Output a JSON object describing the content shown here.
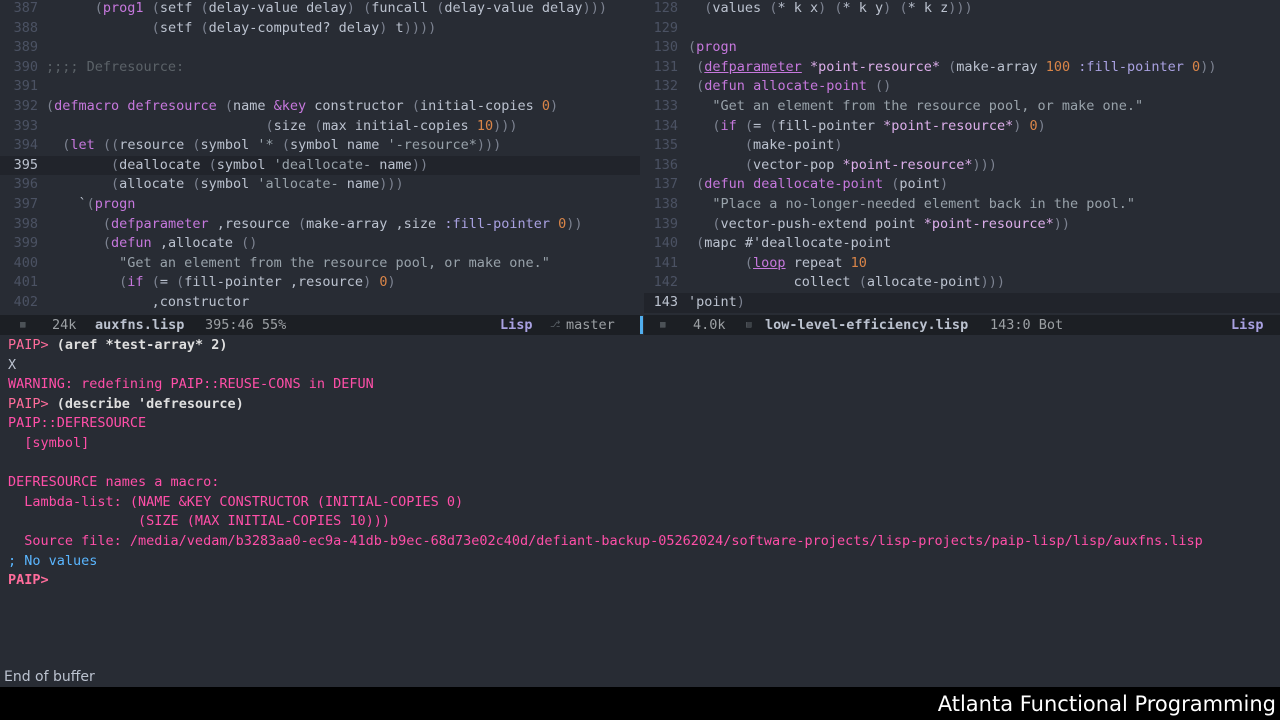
{
  "left_editor": {
    "lines": [
      {
        "num": "387",
        "html": "      <span class='c-paren'>(</span><span class='c-kw'>prog1</span> <span class='c-paren'>(</span>setf <span class='c-paren'>(</span>delay-value delay<span class='c-paren'>)</span> <span class='c-paren'>(</span>funcall <span class='c-paren'>(</span>delay-value delay<span class='c-paren'>)))</span>"
      },
      {
        "num": "388",
        "html": "             <span class='c-paren'>(</span>setf <span class='c-paren'>(</span>delay-computed? delay<span class='c-paren'>)</span> t<span class='c-paren'>))))</span>"
      },
      {
        "num": "389",
        "html": ""
      },
      {
        "num": "390",
        "html": "<span class='c-comment'>;;;; Defresource:</span>"
      },
      {
        "num": "391",
        "html": ""
      },
      {
        "num": "392",
        "html": "<span class='c-paren'>(</span><span class='c-kw'>defmacro</span> <span class='c-fn'>defresource</span> <span class='c-paren'>(</span>name <span class='c-kw'>&amp;key</span> constructor <span class='c-paren'>(</span>initial-copies <span class='c-num'>0</span><span class='c-paren'>)</span>"
      },
      {
        "num": "393",
        "html": "                           <span class='c-paren'>(</span>size <span class='c-paren'>(</span>max initial-copies <span class='c-num'>10</span><span class='c-paren'>)))</span>"
      },
      {
        "num": "394",
        "html": "  <span class='c-paren'>(</span><span class='c-kw'>let</span> <span class='c-paren'>((</span>resource <span class='c-paren'>(</span>symbol <span class='c-str'>'*</span> <span class='c-paren'>(</span>symbol name <span class='c-str'>'-resource*</span><span class='c-paren'>)))</span>"
      },
      {
        "num": "395",
        "html": "        <span class='c-paren'>(</span>deallocate <span class='c-paren'>(</span>symbol <span class='c-str'>'deallocate-</span> name<span class='c-paren'>))</span>",
        "current": true
      },
      {
        "num": "396",
        "html": "        <span class='c-paren'>(</span>allocate <span class='c-paren'>(</span>symbol <span class='c-str'>'allocate-</span> name<span class='c-paren'>)))</span>"
      },
      {
        "num": "397",
        "html": "    `<span class='c-paren'>(</span><span class='c-kw'>progn</span>"
      },
      {
        "num": "398",
        "html": "       <span class='c-paren'>(</span><span class='c-kw'>defparameter</span> ,resource <span class='c-paren'>(</span>make-array ,size <span class='c-key'>:fill-pointer</span> <span class='c-num'>0</span><span class='c-paren'>))</span>"
      },
      {
        "num": "399",
        "html": "       <span class='c-paren'>(</span><span class='c-kw'>defun</span> ,allocate <span class='c-paren'>()</span>"
      },
      {
        "num": "400",
        "html": "         <span class='c-str'>\"Get an element from the resource pool, or make one.\"</span>"
      },
      {
        "num": "401",
        "html": "         <span class='c-paren'>(</span><span class='c-kw'>if</span> <span class='c-paren'>(</span>= <span class='c-paren'>(</span>fill-pointer ,resource<span class='c-paren'>)</span> <span class='c-num'>0</span><span class='c-paren'>)</span>"
      },
      {
        "num": "402",
        "html": "             ,constructor"
      }
    ]
  },
  "right_editor": {
    "lines": [
      {
        "num": "128",
        "html": "  <span class='c-paren'>(</span>values <span class='c-paren'>(</span>* k x<span class='c-paren'>)</span> <span class='c-paren'>(</span>* k y<span class='c-paren'>)</span> <span class='c-paren'>(</span>* k z<span class='c-paren'>)))</span>"
      },
      {
        "num": "129",
        "html": ""
      },
      {
        "num": "130",
        "html": "<span class='c-paren'>(</span><span class='c-kw'>progn</span>"
      },
      {
        "num": "131",
        "html": " <span class='c-paren'>(</span><span class='c-kw' style='text-decoration:underline'>defparameter</span> <span class='c-var'>*point-resource*</span> <span class='c-paren'>(</span>make-array <span class='c-num'>100</span> <span class='c-key'>:fill-pointer</span> <span class='c-num'>0</span><span class='c-paren'>))</span>"
      },
      {
        "num": "132",
        "html": " <span class='c-paren'>(</span><span class='c-kw'>defun</span> <span class='c-fn'>allocate-point</span> <span class='c-paren'>()</span>"
      },
      {
        "num": "133",
        "html": "   <span class='c-str'>\"Get an element from the resource pool, or make one.\"</span>"
      },
      {
        "num": "134",
        "html": "   <span class='c-paren'>(</span><span class='c-kw'>if</span> <span class='c-paren'>(</span>= <span class='c-paren'>(</span>fill-pointer <span class='c-var'>*point-resource*</span><span class='c-paren'>)</span> <span class='c-num'>0</span><span class='c-paren'>)</span>"
      },
      {
        "num": "135",
        "html": "       <span class='c-paren'>(</span>make-point<span class='c-paren'>)</span>"
      },
      {
        "num": "136",
        "html": "       <span class='c-paren'>(</span>vector-pop <span class='c-var'>*point-resource*</span><span class='c-paren'>)))</span>"
      },
      {
        "num": "137",
        "html": " <span class='c-paren'>(</span><span class='c-kw'>defun</span> <span class='c-fn'>deallocate-point</span> <span class='c-paren'>(</span>point<span class='c-paren'>)</span>"
      },
      {
        "num": "138",
        "html": "   <span class='c-str'>\"Place a no-longer-needed element back in the pool.\"</span>"
      },
      {
        "num": "139",
        "html": "   <span class='c-paren'>(</span>vector-push-extend point <span class='c-var'>*point-resource*</span><span class='c-paren'>))</span>"
      },
      {
        "num": "140",
        "html": " <span class='c-paren'>(</span>mapc #'deallocate-point"
      },
      {
        "num": "141",
        "html": "       <span class='c-paren'>(</span><span class='c-kw' style='text-decoration:underline'>loop</span> repeat <span class='c-num'>10</span>"
      },
      {
        "num": "142",
        "html": "             collect <span class='c-paren'>(</span>allocate-point<span class='c-paren'>)))</span>"
      },
      {
        "num": "143",
        "html": "'point<span class='c-paren'>)</span>",
        "current": true
      }
    ]
  },
  "left_modeline": {
    "size": "24k",
    "buffer": "auxfns.lisp",
    "position": "395:46 55%",
    "mode": "Lisp",
    "branch": "master",
    "icon": "lisp-file-icon"
  },
  "right_modeline": {
    "size": "4.0k",
    "buffer": "low-level-efficiency.lisp",
    "position": "143:0 Bot",
    "mode": "Lisp",
    "icon": "lisp-file-icon"
  },
  "repl": {
    "lines": [
      {
        "cls": "",
        "parts": [
          {
            "c": "prompt",
            "t": "PAIP> "
          },
          {
            "c": "cmd",
            "t": "(aref *test-array* 2)"
          }
        ]
      },
      {
        "cls": "",
        "parts": [
          {
            "c": "plain",
            "t": "X"
          }
        ]
      },
      {
        "cls": "",
        "parts": [
          {
            "c": "warn",
            "t": "WARNING: redefining PAIP::REUSE-CONS in DEFUN"
          }
        ]
      },
      {
        "cls": "",
        "parts": [
          {
            "c": "prompt",
            "t": "PAIP> "
          },
          {
            "c": "cmd",
            "t": "(describe 'defresource)"
          }
        ]
      },
      {
        "cls": "",
        "parts": [
          {
            "c": "pink",
            "t": "PAIP::DEFRESOURCE"
          }
        ]
      },
      {
        "cls": "",
        "parts": [
          {
            "c": "pink",
            "t": "  [symbol]"
          }
        ]
      },
      {
        "cls": "",
        "parts": [
          {
            "c": "pink",
            "t": ""
          }
        ]
      },
      {
        "cls": "",
        "parts": [
          {
            "c": "pink",
            "t": "DEFRESOURCE names a macro:"
          }
        ]
      },
      {
        "cls": "",
        "parts": [
          {
            "c": "pink",
            "t": "  Lambda-list: (NAME &KEY CONSTRUCTOR (INITIAL-COPIES 0)"
          }
        ]
      },
      {
        "cls": "",
        "parts": [
          {
            "c": "pink",
            "t": "                (SIZE (MAX INITIAL-COPIES 10)))"
          }
        ]
      },
      {
        "cls": "",
        "parts": [
          {
            "c": "pink",
            "t": "  Source file: /media/vedam/b3283aa0-ec9a-41db-b9ec-68d73e02c40d/defiant-backup-05262024/software-projects/lisp-projects/paip-lisp/lisp/auxfns.lisp"
          }
        ]
      },
      {
        "cls": "",
        "parts": [
          {
            "c": "cmt",
            "t": "; No values"
          }
        ]
      },
      {
        "cls": "",
        "parts": [
          {
            "c": "prompt-b",
            "t": "PAIP>"
          }
        ]
      }
    ]
  },
  "minibuffer": "End of buffer",
  "footer": "Atlanta Functional Programming",
  "colors": {
    "background": "#282c34",
    "modeline_bg": "#1c1f24",
    "keyword": "#c678dd",
    "number": "#da8548",
    "repl_output": "#ff4fa8",
    "active_window_bar": "#51afef"
  }
}
